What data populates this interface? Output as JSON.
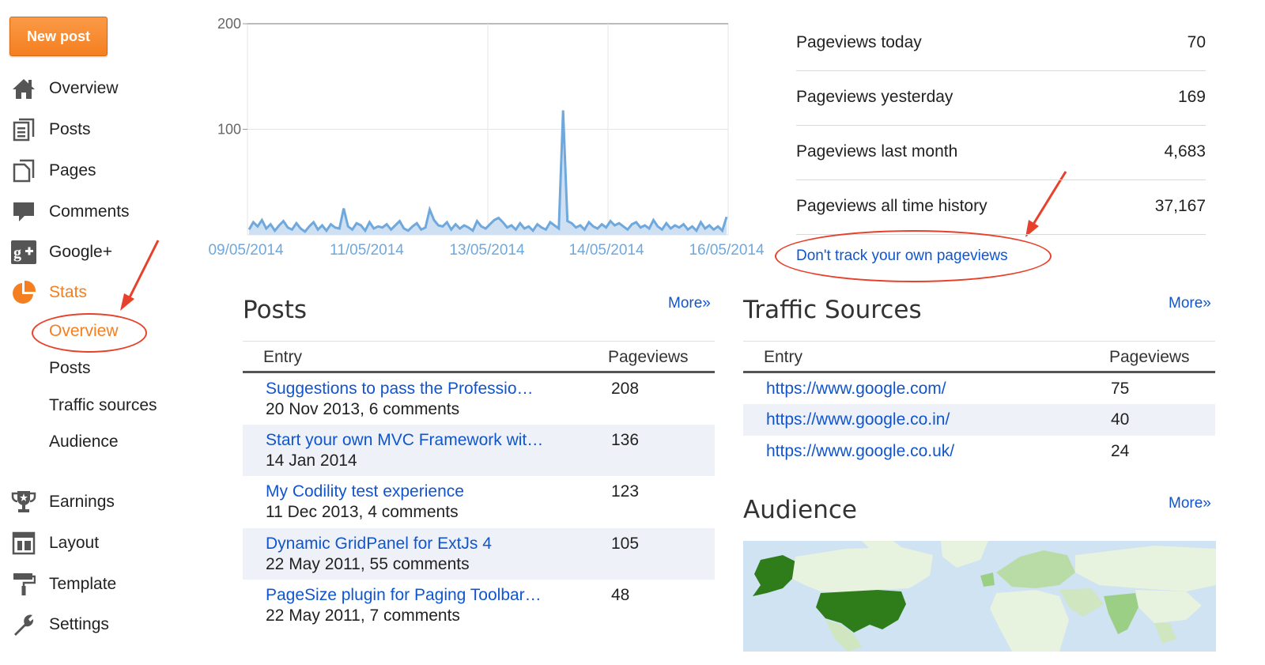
{
  "sidebar": {
    "new_post": "New post",
    "items": [
      {
        "label": "Overview",
        "icon": "home-icon"
      },
      {
        "label": "Posts",
        "icon": "posts-icon"
      },
      {
        "label": "Pages",
        "icon": "pages-icon"
      },
      {
        "label": "Comments",
        "icon": "comment-icon"
      },
      {
        "label": "Google+",
        "icon": "google-plus-icon"
      },
      {
        "label": "Stats",
        "icon": "pie-chart-icon",
        "active": true
      }
    ],
    "stats_sub": [
      {
        "label": "Overview",
        "active": true
      },
      {
        "label": "Posts"
      },
      {
        "label": "Traffic sources"
      },
      {
        "label": "Audience"
      }
    ],
    "items_bottom": [
      {
        "label": "Earnings",
        "icon": "trophy-icon"
      },
      {
        "label": "Layout",
        "icon": "layout-icon"
      },
      {
        "label": "Template",
        "icon": "paint-roller-icon"
      },
      {
        "label": "Settings",
        "icon": "wrench-icon"
      }
    ]
  },
  "chart_data": {
    "type": "area",
    "title": "",
    "xlabel": "",
    "ylabel": "",
    "ylim": [
      0,
      200
    ],
    "yticks": [
      "200",
      "100"
    ],
    "x_tick_labels": [
      "09/05/2014",
      "11/05/2014",
      "13/05/2014",
      "14/05/2014",
      "16/05/2014"
    ],
    "grid": true,
    "series_color": "#6fa8dc",
    "values": [
      5,
      12,
      8,
      14,
      6,
      10,
      4,
      9,
      13,
      7,
      5,
      11,
      6,
      3,
      8,
      12,
      5,
      9,
      4,
      10,
      7,
      6,
      25,
      8,
      5,
      11,
      9,
      4,
      12,
      6,
      8,
      7,
      10,
      5,
      9,
      13,
      6,
      4,
      8,
      11,
      5,
      7,
      24,
      14,
      9,
      8,
      12,
      5,
      10,
      6,
      9,
      7,
      4,
      13,
      8,
      6,
      10,
      14,
      16,
      12,
      7,
      9,
      5,
      11,
      6,
      8,
      4,
      10,
      7,
      5,
      12,
      9,
      6,
      118,
      13,
      11,
      7,
      9,
      5,
      12,
      8,
      6,
      10,
      7,
      13,
      9,
      11,
      8,
      5,
      10,
      12,
      7,
      9,
      6,
      14,
      8,
      5,
      11,
      6,
      9,
      7,
      10,
      5,
      8,
      4,
      12,
      6,
      9,
      5,
      8,
      4,
      17
    ]
  },
  "stats": [
    {
      "label": "Pageviews today",
      "value": "70"
    },
    {
      "label": "Pageviews yesterday",
      "value": "169"
    },
    {
      "label": "Pageviews last month",
      "value": "4,683"
    },
    {
      "label": "Pageviews all time history",
      "value": "37,167"
    }
  ],
  "track_link": "Don't track your own pageviews",
  "posts": {
    "title": "Posts",
    "more": "More»",
    "col_entry": "Entry",
    "col_views": "Pageviews",
    "rows": [
      {
        "title": "Suggestions to pass the Professio…",
        "meta": "20 Nov 2013, 6 comments",
        "views": "208"
      },
      {
        "title": "Start your own MVC Framework wit…",
        "meta": "14 Jan 2014",
        "views": "136"
      },
      {
        "title": "My Codility test experience",
        "meta": "11 Dec 2013, 4 comments",
        "views": "123"
      },
      {
        "title": "Dynamic GridPanel for ExtJs 4",
        "meta": "22 May 2011, 55 comments",
        "views": "105"
      },
      {
        "title": "PageSize plugin for Paging Toolbar…",
        "meta": "22 May 2011, 7 comments",
        "views": "48"
      }
    ]
  },
  "traffic": {
    "title": "Traffic Sources",
    "more": "More»",
    "col_entry": "Entry",
    "col_views": "Pageviews",
    "rows": [
      {
        "url": "https://www.google.com/",
        "views": "75"
      },
      {
        "url": "https://www.google.co.in/",
        "views": "40"
      },
      {
        "url": "https://www.google.co.uk/",
        "views": "24"
      }
    ]
  },
  "audience": {
    "title": "Audience",
    "more": "More»"
  },
  "colors": {
    "accent": "#f47f20",
    "link": "#1155cc",
    "annotation": "#e8412b",
    "map_dark": "#2e7d1a",
    "map_light": "#b9dca7"
  }
}
